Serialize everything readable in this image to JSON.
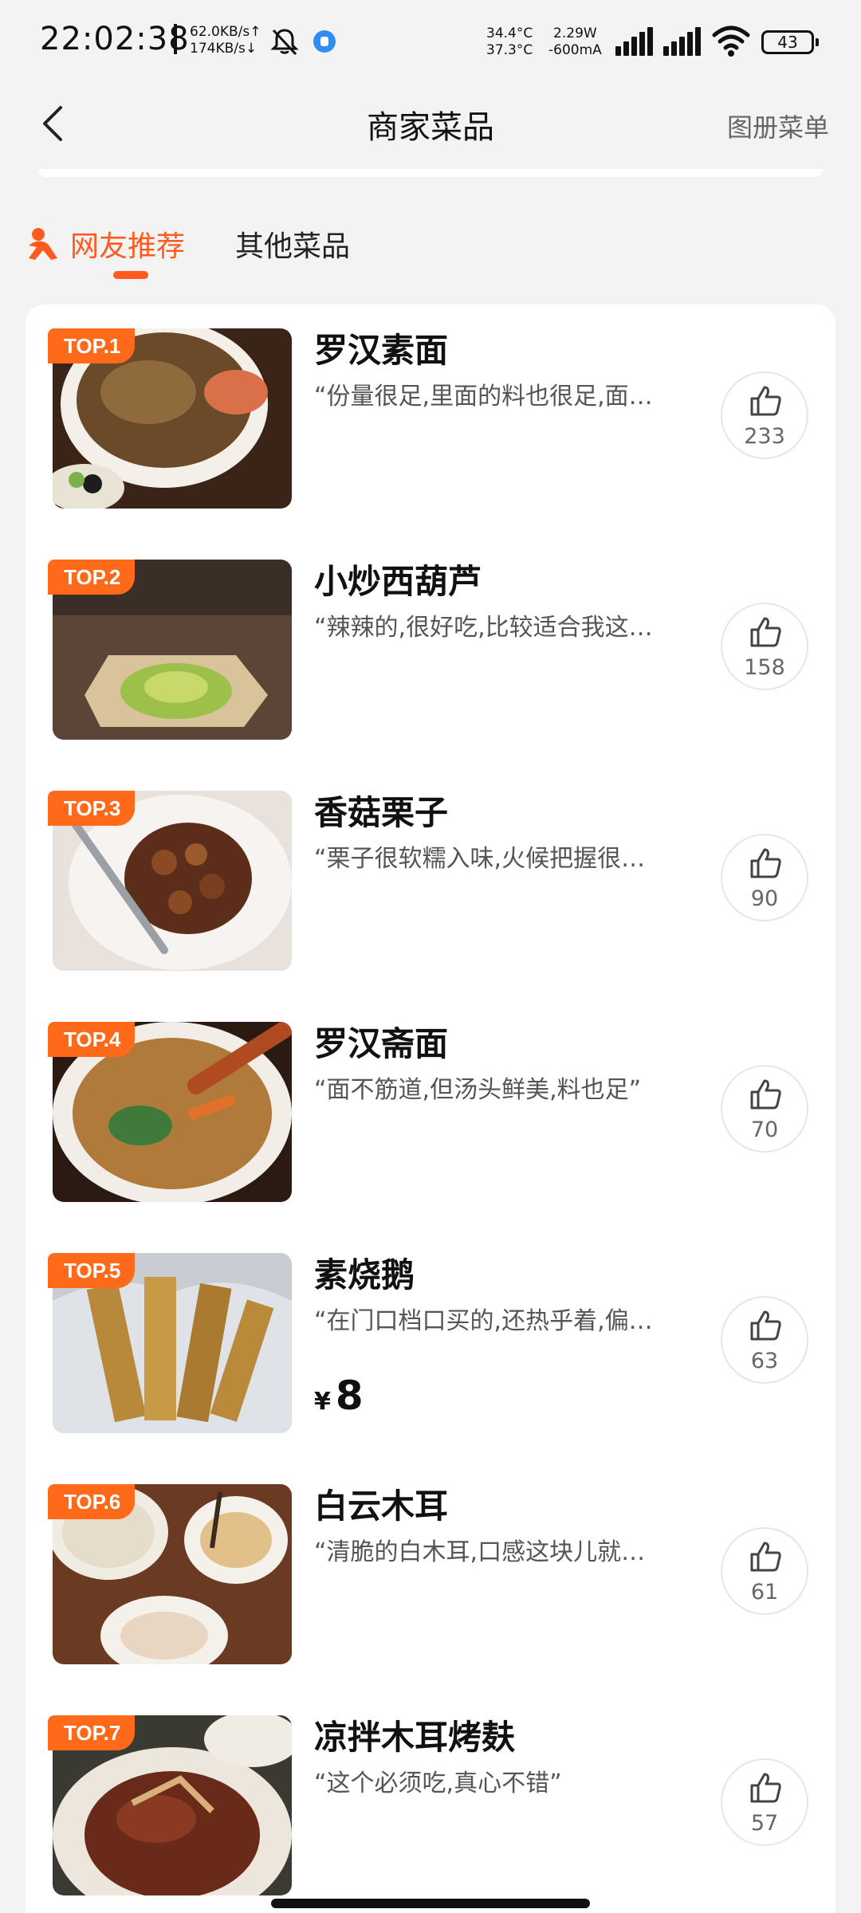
{
  "status_bar": {
    "time": "22:02:38",
    "net_up": "62.0KB/s↑",
    "net_down": "174KB/s↓",
    "temp1": "34.4°C",
    "temp2": "37.3°C",
    "power": "2.29W",
    "current": "-600mA",
    "battery": "43",
    "icons": [
      "bell-mute-icon",
      "app-notification-icon",
      "signal-icon",
      "signal-icon",
      "wifi-icon",
      "battery-icon"
    ]
  },
  "nav": {
    "back_icon": "chevron-left-icon",
    "title": "商家菜品",
    "album_label": "图册菜单"
  },
  "tabs": [
    {
      "label": "网友推荐",
      "icon": "person-icon",
      "active": true
    },
    {
      "label": "其他菜品",
      "active": false
    }
  ],
  "colors": {
    "accent": "#ff5a1f",
    "badge": "#ff6a1a"
  },
  "dishes": [
    {
      "rank": "TOP.1",
      "name": "罗汉素面",
      "review": "“份量很足,里面的料也很足,面…",
      "likes": "233",
      "price_symbol": "",
      "price": ""
    },
    {
      "rank": "TOP.2",
      "name": "小炒西葫芦",
      "review": "“辣辣的,很好吃,比较适合我这…",
      "likes": "158",
      "price_symbol": "",
      "price": ""
    },
    {
      "rank": "TOP.3",
      "name": "香菇栗子",
      "review": "“栗子很软糯入味,火候把握很…",
      "likes": "90",
      "price_symbol": "",
      "price": ""
    },
    {
      "rank": "TOP.4",
      "name": "罗汉斋面",
      "review": "“面不筋道,但汤头鲜美,料也足”",
      "likes": "70",
      "price_symbol": "",
      "price": ""
    },
    {
      "rank": "TOP.5",
      "name": "素烧鹅",
      "review": "“在门口档口买的,还热乎着,偏…",
      "likes": "63",
      "price_symbol": "¥",
      "price": "8"
    },
    {
      "rank": "TOP.6",
      "name": "白云木耳",
      "review": "“清脆的白木耳,口感这块儿就…",
      "likes": "61",
      "price_symbol": "",
      "price": ""
    },
    {
      "rank": "TOP.7",
      "name": "凉拌木耳烤麸",
      "review": "“这个必须吃,真心不错”",
      "likes": "57",
      "price_symbol": "",
      "price": ""
    }
  ],
  "like_icon": "thumbs-up-icon"
}
